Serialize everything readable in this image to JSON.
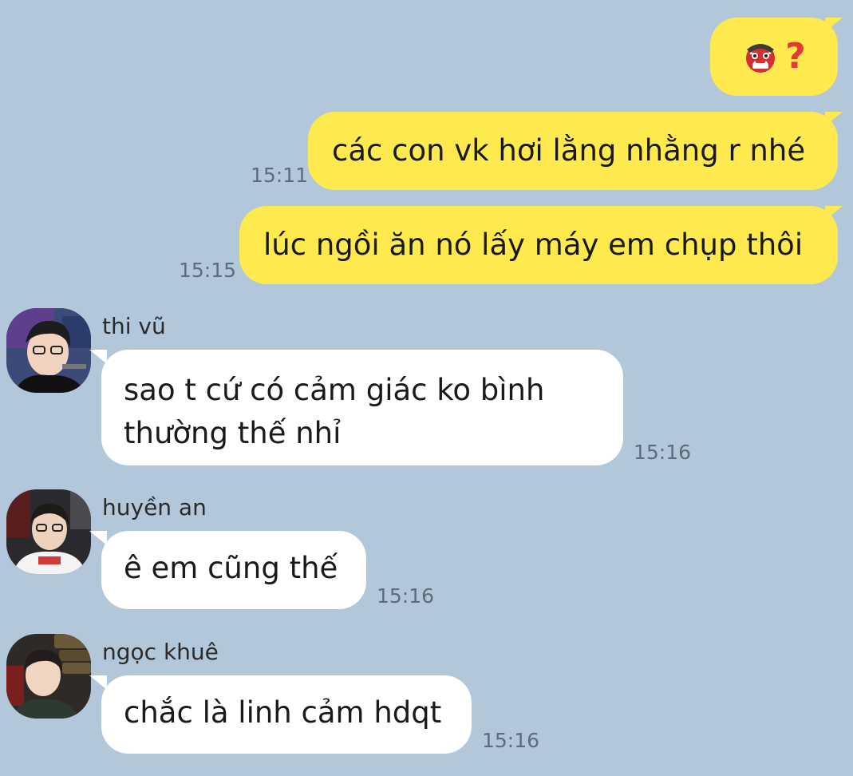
{
  "colors": {
    "background": "#b2c7da",
    "outgoing_bubble": "#fee94e",
    "incoming_bubble": "#ffffff",
    "timestamp": "#5f6b78"
  },
  "messages_out": [
    {
      "icon": "ogre-emoji-icon",
      "text": "?",
      "time": ""
    },
    {
      "text": "các con vk hơi lằng nhằng r nhé",
      "time": "15:11"
    },
    {
      "text": "lúc ngồi ăn nó lấy máy em chụp thôi",
      "time": "15:15"
    }
  ],
  "messages_in": [
    {
      "sender": "thi vũ",
      "lines": [
        "sao t cứ có cảm giác ko bình",
        "thường thế nhỉ"
      ],
      "time": "15:16"
    },
    {
      "sender": "huyền an",
      "text": "ê em cũng thế",
      "time": "15:16"
    },
    {
      "sender": "ngọc khuê",
      "text": "chắc là linh cảm hdqt",
      "time": "15:16"
    }
  ]
}
